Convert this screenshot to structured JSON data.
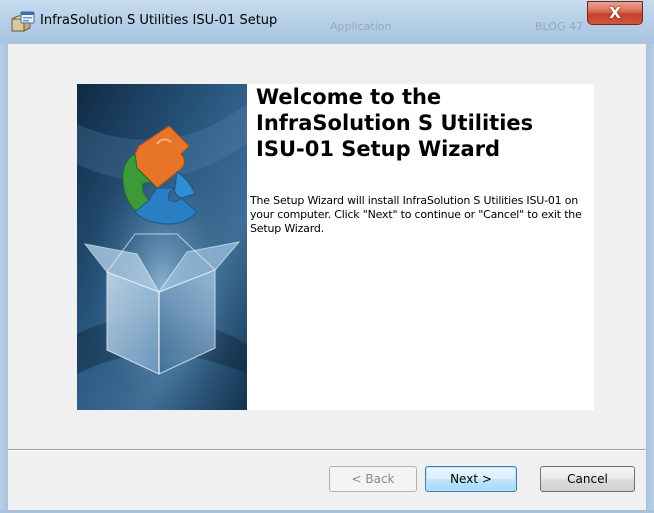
{
  "window": {
    "title": "InfraSolution S Utilities ISU-01 Setup",
    "close_label": "X",
    "ghost_texts": [
      "Application",
      "BLOG 47"
    ]
  },
  "welcome": {
    "title": "Welcome to the\nInfraSolution S Utilities\nISU-01 Setup Wizard",
    "description": "The Setup Wizard will install InfraSolution S Utilities ISU-01 on your computer.  Click \"Next\" to continue or \"Cancel\" to exit the Setup Wizard."
  },
  "buttons": {
    "back": "< Back",
    "next": "Next >",
    "cancel": "Cancel"
  },
  "colors": {
    "banner_dark": "#0f2a44",
    "banner_light": "#5f8db3",
    "puzzle_orange": "#e8742a",
    "puzzle_green": "#3c9a3a",
    "puzzle_blue": "#2a7fc4",
    "close_red": "#c4412a"
  },
  "icons": {
    "title_icon": "setup-package-icon",
    "banner": "open-box-puzzle-illustration"
  }
}
